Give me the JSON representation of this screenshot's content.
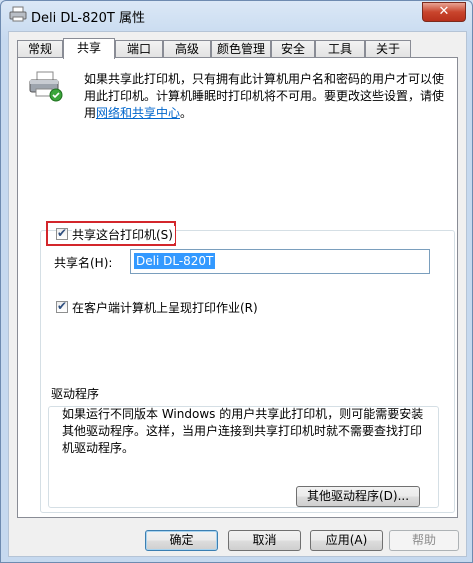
{
  "window": {
    "title": "Deli DL-820T 属性",
    "close_label": "✕"
  },
  "tabs": [
    {
      "label": "常规"
    },
    {
      "label": "共享"
    },
    {
      "label": "端口"
    },
    {
      "label": "高级"
    },
    {
      "label": "颜色管理"
    },
    {
      "label": "安全"
    },
    {
      "label": "工具"
    },
    {
      "label": "关于"
    }
  ],
  "info": {
    "text": "如果共享此打印机，只有拥有此计算机用户名和密码的用户才可以使用此打印机。计算机睡眠时打印机将不可用。要更改这些设置，请使用",
    "link": "网络和共享中心",
    "suffix": "。"
  },
  "share": {
    "checkbox_label": "共享这台打印机(S)",
    "checked": true,
    "name_label": "共享名(H):",
    "name_value": "Deli DL-820T",
    "render_label": "在客户端计算机上呈现打印作业(R)",
    "render_checked": true
  },
  "driver": {
    "title": "驱动程序",
    "text": "如果运行不同版本 Windows 的用户共享此打印机，则可能需要安装其他驱动程序。这样，当用户连接到共享打印机时就不需要查找打印机驱动程序。",
    "button": "其他驱动程序(D)..."
  },
  "buttons": {
    "ok": "确定",
    "cancel": "取消",
    "apply": "应用(A)",
    "help": "帮助"
  }
}
